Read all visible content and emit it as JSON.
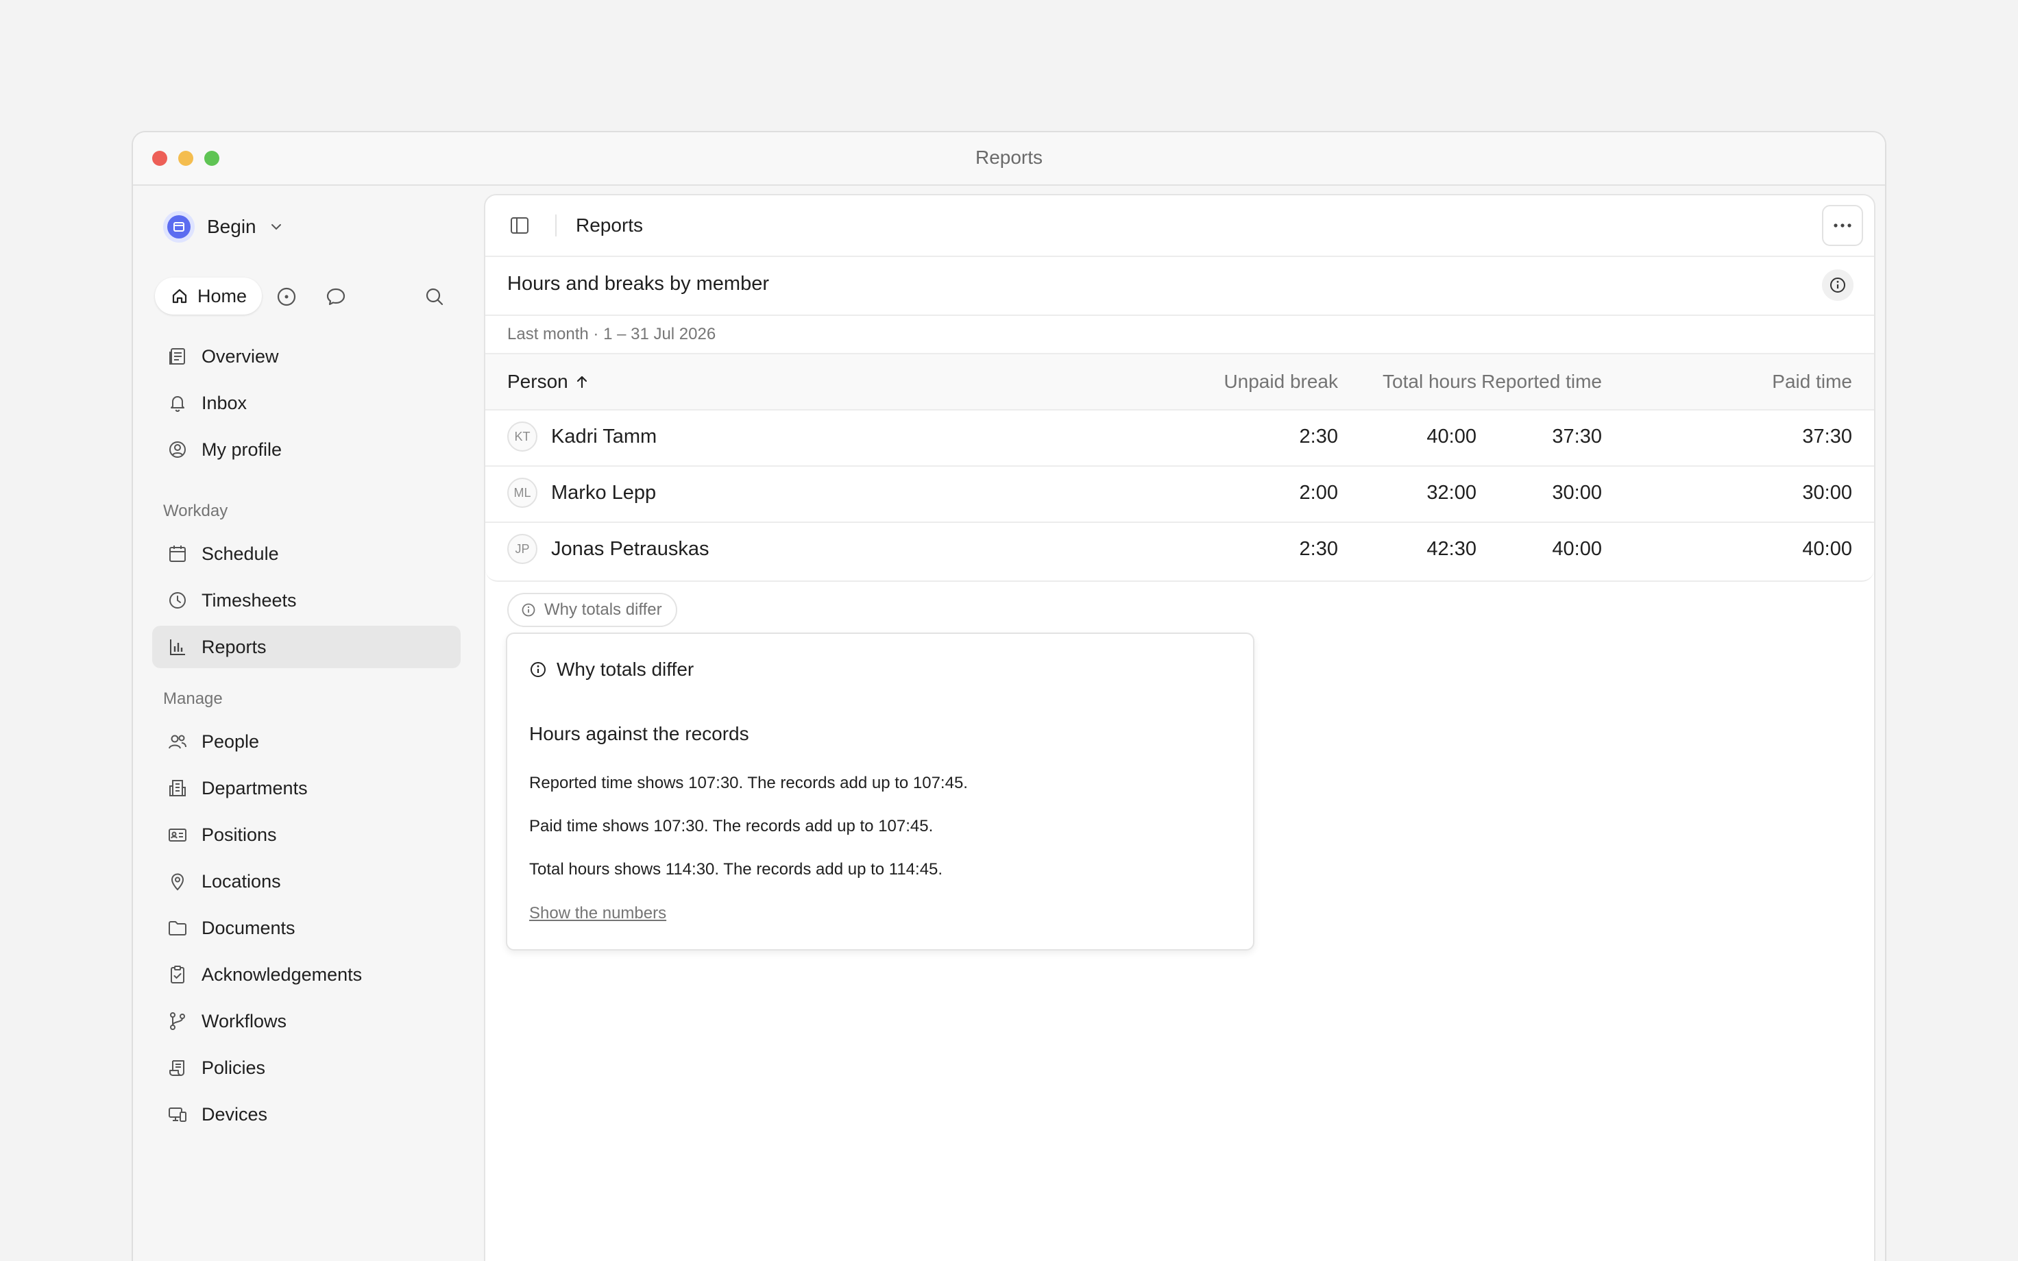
{
  "window": {
    "title": "Reports"
  },
  "sidebar": {
    "workspace": "Begin",
    "home_label": "Home",
    "main_items": [
      {
        "label": "Overview",
        "icon": "overview-icon"
      },
      {
        "label": "Inbox",
        "icon": "bell-icon"
      },
      {
        "label": "My profile",
        "icon": "profile-icon"
      }
    ],
    "workday_label": "Workday",
    "workday_items": [
      {
        "label": "Schedule",
        "icon": "calendar-icon"
      },
      {
        "label": "Timesheets",
        "icon": "clock-icon"
      },
      {
        "label": "Reports",
        "icon": "bar-chart-icon",
        "active": true
      }
    ],
    "manage_label": "Manage",
    "manage_items": [
      {
        "label": "People",
        "icon": "people-icon"
      },
      {
        "label": "Departments",
        "icon": "building-icon"
      },
      {
        "label": "Positions",
        "icon": "id-card-icon"
      },
      {
        "label": "Locations",
        "icon": "map-pin-icon"
      },
      {
        "label": "Documents",
        "icon": "folder-icon"
      },
      {
        "label": "Acknowledgements",
        "icon": "clipboard-check-icon"
      },
      {
        "label": "Workflows",
        "icon": "git-branch-icon"
      },
      {
        "label": "Policies",
        "icon": "scroll-icon"
      },
      {
        "label": "Devices",
        "icon": "devices-icon"
      }
    ]
  },
  "toolbar": {
    "title": "Reports"
  },
  "report": {
    "title": "Hours and breaks by member",
    "period": "Last month · 1 – 31 Jul 2026",
    "columns": [
      "Person",
      "Total hours",
      "Unpaid break",
      "Reported time",
      "Paid time"
    ],
    "rows": [
      {
        "initials": "KT",
        "name": "Kadri Tamm",
        "total": "40:00",
        "unpaid": "2:30",
        "reported": "37:30",
        "paid": "37:30"
      },
      {
        "initials": "ML",
        "name": "Marko Lepp",
        "total": "32:00",
        "unpaid": "2:00",
        "reported": "30:00",
        "paid": "30:00"
      },
      {
        "initials": "JP",
        "name": "Jonas Petrauskas",
        "total": "42:30",
        "unpaid": "2:30",
        "reported": "40:00",
        "paid": "40:00"
      }
    ]
  },
  "why": {
    "chip_label": "Why totals differ",
    "title": "Why totals differ",
    "subtitle": "Hours against the records",
    "lines": [
      "Reported time shows 107:30. The records add up to 107:45.",
      "Paid time shows 107:30. The records add up to 107:45.",
      "Total hours shows 114:30. The records add up to 114:45."
    ],
    "link": "Show the numbers"
  },
  "colors": {
    "accent": "#5b6cf0",
    "active_bg": "#e7e7e7"
  }
}
